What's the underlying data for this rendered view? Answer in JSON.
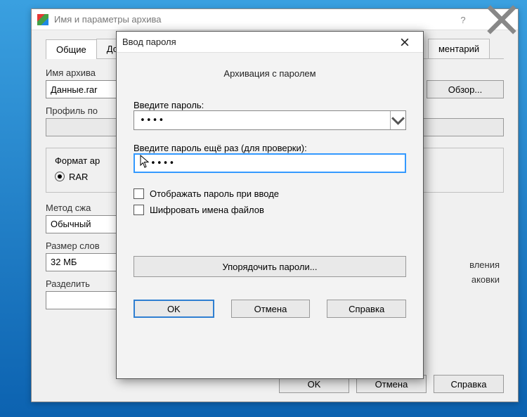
{
  "main": {
    "title": "Имя и параметры архива",
    "tabs": {
      "general": "Общие",
      "advanced": "Доп",
      "comment": "ментарий"
    },
    "archive_name_label": "Имя архива",
    "archive_name_value": "Данные.rar",
    "browse_button": "Обзор...",
    "profile_label": "Профиль по",
    "format_group": "Формат ар",
    "format_rar": "RAR",
    "method_label": "Метод сжа",
    "method_value": "Обычный",
    "dict_label": "Размер слов",
    "dict_value": "32 МБ",
    "split_label": "Разделить",
    "right_hint1": "вления",
    "right_hint2": "аковки",
    "buttons": {
      "ok": "OK",
      "cancel": "Отмена",
      "help": "Справка"
    }
  },
  "modal": {
    "title": "Ввод пароля",
    "subtitle": "Архивация с паролем",
    "password_label": "Введите пароль:",
    "password_value": "••••",
    "password2_label": "Введите пароль ещё раз (для проверки):",
    "password2_value": "••••",
    "show_password": "Отображать пароль при вводе",
    "encrypt_names": "Шифровать имена файлов",
    "organize": "Упорядочить пароли...",
    "buttons": {
      "ok": "OK",
      "cancel": "Отмена",
      "help": "Справка"
    }
  }
}
